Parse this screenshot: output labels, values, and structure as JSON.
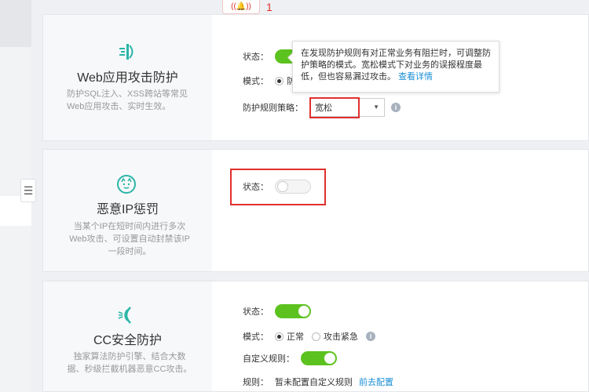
{
  "alarm": {
    "count": "1"
  },
  "web_panel": {
    "title": "Web应用攻击防护",
    "desc": "防护SQL注入、XSS跨站等常见Web应用攻击、实时生效。",
    "status_label": "状态：",
    "mode_label": "模式：",
    "mode_partial": "防",
    "strategy_label": "防护规则策略：",
    "strategy_value": "宽松",
    "tooltip_text": "在发现防护规则有对正常业务有阻拦时，可调整防护策略的模式。宽松模式下对业务的误报程度最低，但也容易漏过攻击。",
    "tooltip_link": "查看详情"
  },
  "ip_panel": {
    "title": "恶意IP惩罚",
    "desc": "当某个IP在短时间内进行多次Web攻击、可设置自动封禁该IP一段时间。",
    "status_label": "状态："
  },
  "cc_panel": {
    "title": "CC安全防护",
    "desc": "独家算法防护引擎、结合大数据、秒级拦截机器恶意CC攻击。",
    "status_label": "状态：",
    "mode_label": "模式：",
    "mode_normal": "正常",
    "mode_emergency": "攻击紧急",
    "custom_rule_label": "自定义规则：",
    "rule_label": "规则：",
    "rule_value": "暂未配置自定义规则",
    "rule_link": "前去配置"
  },
  "colors": {
    "accent": "#5cc21f",
    "link": "#1a8fd6",
    "highlight": "#e0302d",
    "icon": "#2bb5a7"
  }
}
